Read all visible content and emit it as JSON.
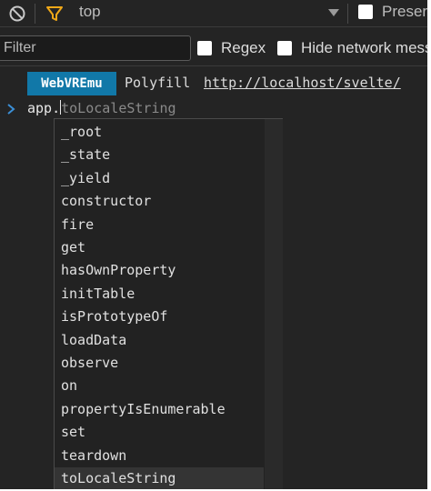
{
  "toolbar": {
    "context": "top",
    "preserve_label": "Preserve log"
  },
  "filter_row": {
    "filter_placeholder": "Filter",
    "regex_label": "Regex",
    "hide_network_label": "Hide network messages"
  },
  "log": {
    "badge": "WebVREmu",
    "text": "Polyfill",
    "link": "http://localhost/svelte/"
  },
  "prompt": {
    "typed": "app.",
    "suggestion": "toLocaleString"
  },
  "autocomplete": {
    "items": [
      "_root",
      "_state",
      "_yield",
      "constructor",
      "fire",
      "get",
      "hasOwnProperty",
      "initTable",
      "isPrototypeOf",
      "loadData",
      "observe",
      "on",
      "propertyIsEnumerable",
      "set",
      "teardown",
      "toLocaleString"
    ],
    "selected_index": 15
  },
  "colors": {
    "background": "#242424",
    "badge": "#1178a8",
    "filter_icon": "#f0a818",
    "prompt_chevron": "#3b8fd6"
  },
  "icons": {
    "clear": "clear-console-icon",
    "filter": "filter-icon",
    "dropdown": "dropdown-arrow-icon",
    "prompt": "prompt-chevron-icon"
  }
}
